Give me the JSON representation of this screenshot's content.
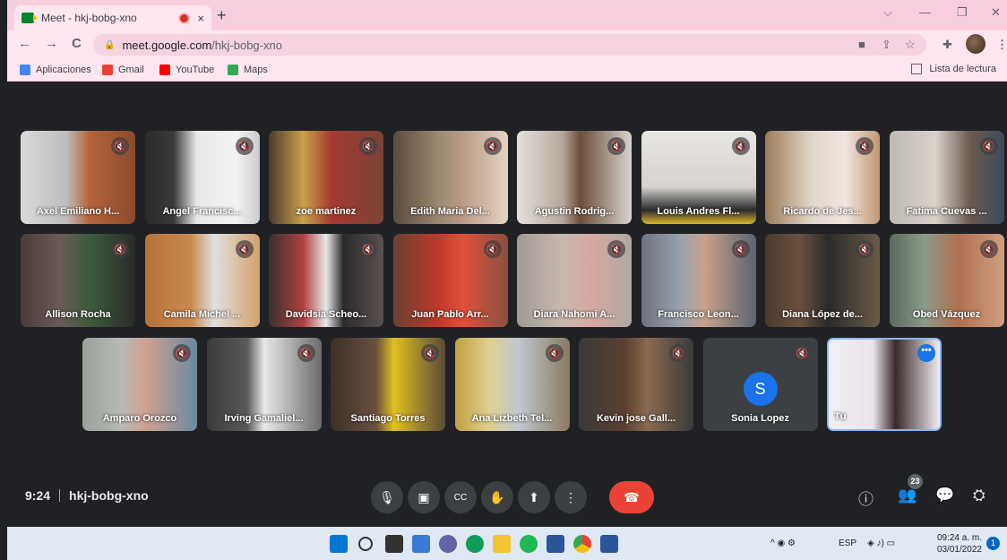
{
  "browser": {
    "tab_title": "Meet - hkj-bobg-xno",
    "tab_close": "×",
    "new_tab": "+",
    "url_host": "meet.google.com",
    "url_path": "/hkj-bobg-xno",
    "window_controls": [
      "⌵",
      "—",
      "❐",
      "✕"
    ],
    "nav": {
      "back": "←",
      "forward": "→",
      "reload": "C"
    },
    "bookmarks": [
      {
        "label": "Aplicaciones",
        "icon": "apps-grid-icon",
        "color": "#4285f4"
      },
      {
        "label": "Gmail",
        "icon": "gmail-icon",
        "color": "#ea4335"
      },
      {
        "label": "YouTube",
        "icon": "youtube-icon",
        "color": "#ff0000"
      },
      {
        "label": "Maps",
        "icon": "maps-icon",
        "color": "#34a853"
      }
    ],
    "reading_list": "Lista de lectura"
  },
  "meet": {
    "row1": [
      {
        "name": "Axel Emiliano H...",
        "bg": "linear-gradient(90deg,#d9d9d9 0%,#bdbdbd 40%,#b5633a 60%,#8a4b2c 100%)"
      },
      {
        "name": "Angel Francisc...",
        "bg": "linear-gradient(90deg,#2b2b2b 0%,#3a3a3a 25%,#e9e9e9 45%,#f2f2f2 80%,#ccc 100%)"
      },
      {
        "name": "zoe martinez",
        "bg": "linear-gradient(90deg,#4a3b2e 0%,#c9a14a 30%,#a43a2e 55%,#7a4438 100%)"
      },
      {
        "name": "Edith Maria Del...",
        "bg": "linear-gradient(90deg,#5b4a3b 0%,#9a8a73 40%,#b89a87 60%,#e5d4c3 100%)"
      },
      {
        "name": "Agustin Rodrig...",
        "bg": "linear-gradient(90deg,#e3e0dd 0%,#b6a89a 40%,#6b4e3a 55%,#d8d3cf 100%)"
      },
      {
        "name": "Louis Andres Fl...",
        "bg": "linear-gradient(180deg,#e8e6e3 0%,#d6d3cf 60%,#2b2b2b 85%,#d9b52a 100%)"
      },
      {
        "name": "Ricardo de Jes...",
        "bg": "linear-gradient(90deg,#9b7a5a 0%,#e0d6c8 40%,#f0e6e1 70%,#c29670 100%)"
      },
      {
        "name": "Fatima Cuevas ...",
        "bg": "linear-gradient(90deg,#bfbab2 0%,#d8d2c9 40%,#6b5a4f 70%,#3d4a5c 100%)"
      }
    ],
    "row2": [
      {
        "name": "Allison Rocha",
        "bg": "linear-gradient(90deg,#4a3b3a 0%,#6a5a58 35%,#3c5a3a 60%,#2b2b2b 100%)"
      },
      {
        "name": "Camila Michel ...",
        "bg": "linear-gradient(90deg,#b8703a 0%,#c98a4f 40%,#e0e0e0 60%,#d4a06a 100%)"
      },
      {
        "name": "Davidsia Scheo...",
        "bg": "linear-gradient(90deg,#3a3030 0%,#b04040 30%,#e8e8e8 50%,#2b2b2b 65%,#5a5050 100%)"
      },
      {
        "name": "Juan Pablo Arr...",
        "bg": "linear-gradient(90deg,#6a4030 0%,#c0392b 40%,#e0503a 60%,#8a5040 100%)"
      },
      {
        "name": "Diara Nahomi A...",
        "bg": "linear-gradient(90deg,#a09a95 0%,#c8b8ae 40%,#d4a8a0 65%,#b0a8a2 100%)"
      },
      {
        "name": "Francisco Leon...",
        "bg": "linear-gradient(90deg,#6a7480 0%,#9aa3ad 35%,#c9a08a 55%,#5b6470 100%)"
      },
      {
        "name": "Diana López de...",
        "bg": "linear-gradient(90deg,#4a3a2a 0%,#6a5040 30%,#2b2b2b 55%,#6a5a48 100%)"
      },
      {
        "name": "Obed Vázquez",
        "bg": "linear-gradient(90deg,#5a6a5a 0%,#8a9a8a 30%,#b07050 60%,#d0a080 100%)"
      }
    ],
    "row3": [
      {
        "name": "Amparo Orozco",
        "bg": "linear-gradient(90deg,#9aa09a 0%,#b8bab5 35%,#d0a090 55%,#6a8aa0 100%)"
      },
      {
        "name": "Irving Gamaliel...",
        "bg": "linear-gradient(90deg,#3a3a3a 0%,#5a5a5a 35%,#e8e8e8 50%,#6a6a6a 100%)"
      },
      {
        "name": "Santiago Torres",
        "bg": "linear-gradient(90deg,#3a3028 0%,#6a5040 40%,#e0c020 55%,#5a4a3a 100%)"
      },
      {
        "name": "Ana Lizbeth Tel...",
        "bg": "linear-gradient(90deg,#c0a040 0%,#e0d090 30%,#c0c8d0 55%,#8a7a60 100%)"
      },
      {
        "name": "Kevin jose Gall...",
        "bg": "linear-gradient(90deg,#3a3a3a 0%,#5a4030 40%,#8a6a50 60%,#3a3a3a 100%)"
      },
      {
        "name": "Sonia Lopez",
        "initial": "S",
        "bg": "#3c4043"
      },
      {
        "name": "Tú",
        "bg": "linear-gradient(90deg,#f2f0f3 0%,#e8e4ea 40%,#3a2a2a 60%,#f0eef2 100%)",
        "self": true
      }
    ],
    "meeting_time": "9:24",
    "meeting_code": "hkj-bobg-xno",
    "controls": [
      {
        "label": "🎙",
        "name": "microphone-button"
      },
      {
        "label": "▣",
        "name": "camera-button"
      },
      {
        "label": "CC",
        "name": "captions-button"
      },
      {
        "label": "✋",
        "name": "raise-hand-button"
      },
      {
        "label": "⬆",
        "name": "present-button"
      },
      {
        "label": "⋮",
        "name": "more-options-button"
      },
      {
        "label": "☎",
        "name": "leave-call-button"
      }
    ],
    "participants_count": "23",
    "right_icons": {
      "info": "ⓘ",
      "people": "👥",
      "chat": "💬",
      "activities": "⛭"
    },
    "more_dots": "•••",
    "mute_icon": "🔇"
  },
  "taskbar": {
    "language": "ESP",
    "time": "09:24 a. m.",
    "date": "03/01/2022",
    "notifications": "1",
    "tray_icons": "^  ◉  ⚙",
    "net_icons": "◈  ♪)  ▭"
  }
}
